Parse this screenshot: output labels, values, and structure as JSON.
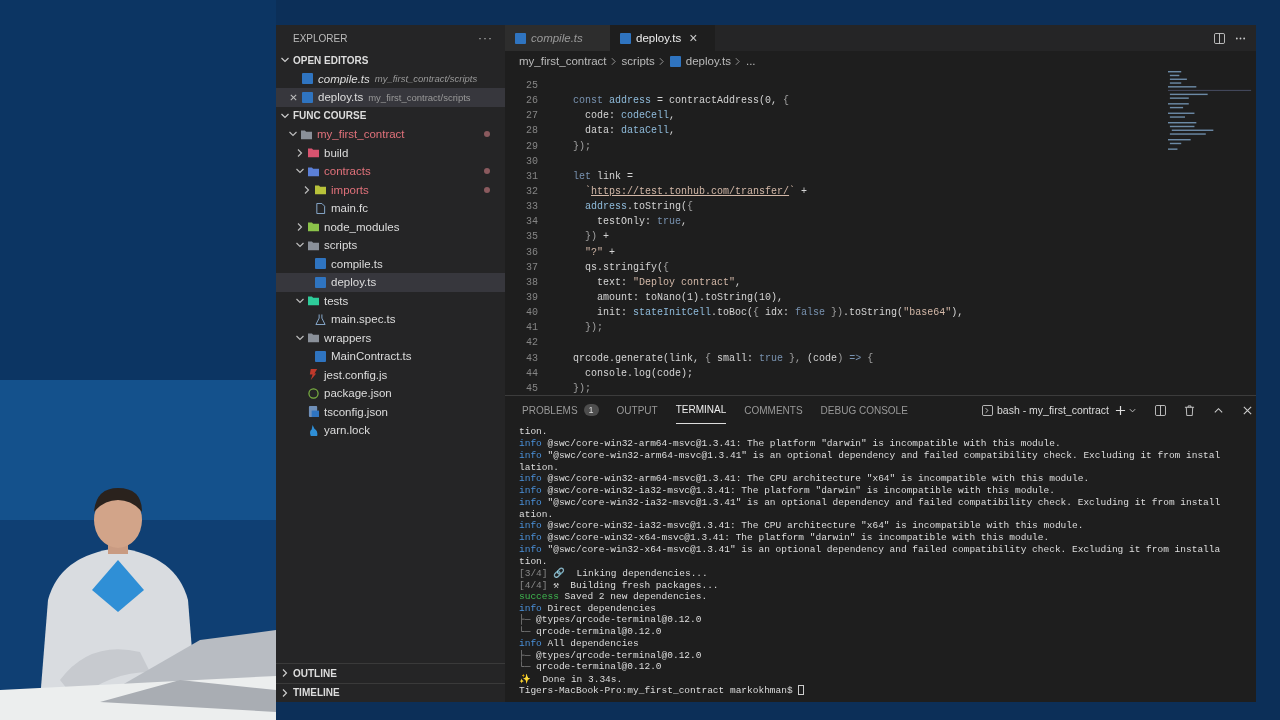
{
  "explorer": {
    "title": "EXPLORER",
    "more": "···",
    "open_editors": {
      "title": "OPEN EDITORS",
      "expanded": true,
      "items": [
        {
          "name": "compile.ts",
          "path": "my_first_contract/scripts",
          "preview": true,
          "selected": false
        },
        {
          "name": "deploy.ts",
          "path": "my_first_contract/scripts",
          "preview": false,
          "selected": true
        }
      ]
    },
    "workspace": {
      "title": "FUNC COURSE",
      "expanded": true
    },
    "tree": [
      {
        "name": "my_first_contract",
        "kind": "folder",
        "color": "#8a9099",
        "expanded": true,
        "modified": true,
        "selected": false,
        "children": [
          {
            "name": "build",
            "kind": "folder",
            "color": "#d9536f",
            "expanded": false,
            "modified": false,
            "selected": false
          },
          {
            "name": "contracts",
            "kind": "folder",
            "color": "#5b7fd6",
            "expanded": true,
            "modified": true,
            "selected": false,
            "children": [
              {
                "name": "imports",
                "kind": "folder",
                "color": "#b8c23a",
                "expanded": false,
                "modified": true,
                "selected": false
              },
              {
                "name": "main.fc",
                "kind": "file",
                "modified": false,
                "selected": false
              }
            ]
          },
          {
            "name": "node_modules",
            "kind": "folder",
            "color": "#8bc34a",
            "expanded": false,
            "modified": false,
            "selected": false
          },
          {
            "name": "scripts",
            "kind": "folder",
            "color": "#8a9099",
            "expanded": true,
            "modified": false,
            "selected": false,
            "children": [
              {
                "name": "compile.ts",
                "kind": "ts",
                "modified": false,
                "selected": false
              },
              {
                "name": "deploy.ts",
                "kind": "ts",
                "modified": false,
                "selected": true
              }
            ]
          },
          {
            "name": "tests",
            "kind": "folder",
            "color": "#2ecc9a",
            "expanded": true,
            "modified": false,
            "selected": false,
            "children": [
              {
                "name": "main.spec.ts",
                "kind": "flask",
                "modified": false,
                "selected": false
              }
            ]
          },
          {
            "name": "wrappers",
            "kind": "folder",
            "color": "#8a9099",
            "expanded": true,
            "modified": false,
            "selected": false,
            "children": [
              {
                "name": "MainContract.ts",
                "kind": "ts",
                "modified": false,
                "selected": false
              }
            ]
          },
          {
            "name": "jest.config.js",
            "kind": "jest",
            "modified": false,
            "selected": false
          },
          {
            "name": "package.json",
            "kind": "json",
            "modified": false,
            "selected": false
          },
          {
            "name": "tsconfig.json",
            "kind": "tsconfig",
            "modified": false,
            "selected": false
          },
          {
            "name": "yarn.lock",
            "kind": "yarn",
            "modified": false,
            "selected": false
          }
        ]
      }
    ],
    "outline": {
      "title": "OUTLINE",
      "expanded": false
    },
    "timeline": {
      "title": "TIMELINE",
      "expanded": false
    }
  },
  "tabs": [
    {
      "label": "compile.ts",
      "preview": true,
      "selected": false
    },
    {
      "label": "deploy.ts",
      "preview": false,
      "selected": true,
      "close": "×"
    }
  ],
  "breadcrumb": [
    "my_first_contract",
    "scripts",
    "deploy.ts",
    "..."
  ],
  "code": [
    {
      "n": "25"
    },
    {
      "n": "26",
      "tokens": [
        {
          "t": "const ",
          "kind": "kw"
        },
        {
          "t": "address",
          "kind": "var"
        },
        {
          "t": " = contractAddress(0, "
        },
        {
          "t": "{",
          "kind": "punct"
        }
      ]
    },
    {
      "n": "27",
      "tokens": [
        {
          "t": "  code: "
        },
        {
          "t": "codeCell",
          "kind": "var"
        },
        {
          "t": ","
        }
      ]
    },
    {
      "n": "28",
      "tokens": [
        {
          "t": "  data: "
        },
        {
          "t": "dataCell",
          "kind": "var"
        },
        {
          "t": ","
        }
      ]
    },
    {
      "n": "29",
      "tokens": [
        {
          "t": "});",
          "kind": "punct"
        }
      ]
    },
    {
      "n": "30"
    },
    {
      "n": "31",
      "tokens": [
        {
          "t": "let",
          "kind": "kw"
        },
        {
          "t": " link ="
        }
      ]
    },
    {
      "n": "32",
      "tokens": [
        {
          "t": "  `",
          "kind": "str"
        },
        {
          "t": "https://test.tonhub.com/transfer/",
          "kind": "link"
        },
        {
          "t": "`",
          "kind": "str"
        },
        {
          "t": " +"
        }
      ]
    },
    {
      "n": "33",
      "tokens": [
        {
          "t": "  address",
          "kind": "var"
        },
        {
          "t": ".toString("
        },
        {
          "t": "{",
          "kind": "punct"
        }
      ]
    },
    {
      "n": "34",
      "tokens": [
        {
          "t": "    testOnly: "
        },
        {
          "t": "true",
          "kind": "kw"
        },
        {
          "t": ","
        }
      ]
    },
    {
      "n": "35",
      "tokens": [
        {
          "t": "  })",
          "kind": "punct"
        },
        {
          "t": " +"
        }
      ]
    },
    {
      "n": "36",
      "tokens": [
        {
          "t": "  \"?\"",
          "kind": "str"
        },
        {
          "t": " +"
        }
      ]
    },
    {
      "n": "37",
      "tokens": [
        {
          "t": "  qs.stringify("
        },
        {
          "t": "{",
          "kind": "punct"
        }
      ]
    },
    {
      "n": "38",
      "tokens": [
        {
          "t": "    text: "
        },
        {
          "t": "\"Deploy contract\"",
          "kind": "str"
        },
        {
          "t": ","
        }
      ]
    },
    {
      "n": "39",
      "tokens": [
        {
          "t": "    amount: toNano(1).toString(10),"
        }
      ]
    },
    {
      "n": "40",
      "tokens": [
        {
          "t": "    init: "
        },
        {
          "t": "stateInitCell",
          "kind": "var"
        },
        {
          "t": ".toBoc("
        },
        {
          "t": "{",
          "kind": "punct"
        },
        {
          "t": " idx: "
        },
        {
          "t": "false",
          "kind": "kw"
        },
        {
          "t": " })",
          "kind": "punct"
        },
        {
          "t": ".toString("
        },
        {
          "t": "\"base64\"",
          "kind": "str"
        },
        {
          "t": "),"
        }
      ]
    },
    {
      "n": "41",
      "tokens": [
        {
          "t": "  });",
          "kind": "punct"
        }
      ]
    },
    {
      "n": "42"
    },
    {
      "n": "43",
      "tokens": [
        {
          "t": "qrcode.generate(link, "
        },
        {
          "t": "{",
          "kind": "punct"
        },
        {
          "t": " small: "
        },
        {
          "t": "true",
          "kind": "kw"
        },
        {
          "t": " },",
          "kind": "punct"
        },
        {
          "t": " ("
        },
        {
          "t": "code"
        },
        {
          "t": ")",
          "kind": "punct"
        },
        {
          "t": " => ",
          "kind": "kw"
        },
        {
          "t": "{",
          "kind": "punct"
        }
      ]
    },
    {
      "n": "44",
      "tokens": [
        {
          "t": "  console.log(code);"
        }
      ]
    },
    {
      "n": "45",
      "tokens": [
        {
          "t": "});",
          "kind": "punct"
        }
      ]
    }
  ],
  "panel": {
    "tabs": [
      {
        "label": "PROBLEMS",
        "badge": "1",
        "selected": false
      },
      {
        "label": "OUTPUT",
        "selected": false
      },
      {
        "label": "TERMINAL",
        "selected": true
      },
      {
        "label": "COMMENTS",
        "selected": false
      },
      {
        "label": "DEBUG CONSOLE",
        "selected": false
      }
    ],
    "terminal_name": "bash - my_first_contract",
    "lines": [
      [
        {
          "t": "tion."
        }
      ],
      [
        {
          "t": "info",
          "kind": "info"
        },
        {
          "t": " @swc/core-win32-arm64-msvc@1.3.41: The platform \"darwin\" is incompatible with this module."
        }
      ],
      [
        {
          "t": "info",
          "kind": "info"
        },
        {
          "t": " \"@swc/core-win32-arm64-msvc@1.3.41\" is an optional dependency and failed compatibility check. Excluding it from instal"
        }
      ],
      [
        {
          "t": "lation."
        }
      ],
      [
        {
          "t": "info",
          "kind": "info"
        },
        {
          "t": " @swc/core-win32-arm64-msvc@1.3.41: The CPU architecture \"x64\" is incompatible with this module."
        }
      ],
      [
        {
          "t": "info",
          "kind": "info"
        },
        {
          "t": " @swc/core-win32-ia32-msvc@1.3.41: The platform \"darwin\" is incompatible with this module."
        }
      ],
      [
        {
          "t": "info",
          "kind": "info"
        },
        {
          "t": " \"@swc/core-win32-ia32-msvc@1.3.41\" is an optional dependency and failed compatibility check. Excluding it from install"
        }
      ],
      [
        {
          "t": "ation."
        }
      ],
      [
        {
          "t": "info",
          "kind": "info"
        },
        {
          "t": " @swc/core-win32-ia32-msvc@1.3.41: The CPU architecture \"x64\" is incompatible with this module."
        }
      ],
      [
        {
          "t": "info",
          "kind": "info"
        },
        {
          "t": " @swc/core-win32-x64-msvc@1.3.41: The platform \"darwin\" is incompatible with this module."
        }
      ],
      [
        {
          "t": "info",
          "kind": "info"
        },
        {
          "t": " \"@swc/core-win32-x64-msvc@1.3.41\" is an optional dependency and failed compatibility check. Excluding it from installa"
        }
      ],
      [
        {
          "t": "tion."
        }
      ],
      [
        {
          "t": "[3/4]",
          "kind": "dim"
        },
        {
          "t": " 🔗  Linking dependencies..."
        }
      ],
      [
        {
          "t": "[4/4]",
          "kind": "dim"
        },
        {
          "t": " ⚒  Building fresh packages..."
        }
      ],
      [
        {
          "t": "success",
          "kind": "success"
        },
        {
          "t": " Saved 2 new dependencies."
        }
      ],
      [
        {
          "t": "info",
          "kind": "info"
        },
        {
          "t": " Direct dependencies"
        }
      ],
      [
        {
          "t": "├─",
          "kind": "dim"
        },
        {
          "t": " @types/qrcode-terminal@0.12.0"
        }
      ],
      [
        {
          "t": "└─",
          "kind": "dim"
        },
        {
          "t": " qrcode-terminal@0.12.0"
        }
      ],
      [
        {
          "t": "info",
          "kind": "info"
        },
        {
          "t": " All dependencies"
        }
      ],
      [
        {
          "t": "├─",
          "kind": "dim"
        },
        {
          "t": " @types/qrcode-terminal@0.12.0"
        }
      ],
      [
        {
          "t": "└─",
          "kind": "dim"
        },
        {
          "t": " qrcode-terminal@0.12.0"
        }
      ],
      [
        {
          "t": "✨  Done in 3.34s."
        }
      ],
      [
        {
          "t": "Tigers-MacBook-Pro:my_first_contract markokhman$ "
        }
      ]
    ]
  }
}
